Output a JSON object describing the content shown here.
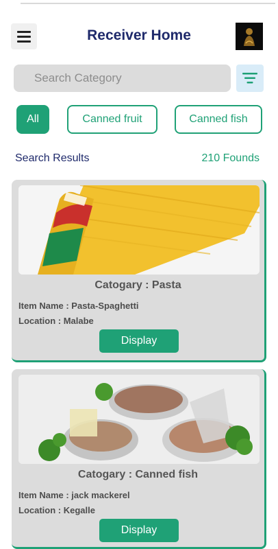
{
  "header": {
    "title": "Receiver Home"
  },
  "search": {
    "placeholder": "Search Category"
  },
  "chips": [
    {
      "label": "All",
      "active": true
    },
    {
      "label": "Canned fruit",
      "active": false
    },
    {
      "label": "Canned fish",
      "active": false
    }
  ],
  "results": {
    "label": "Search Results",
    "count": "210 Founds"
  },
  "cards": [
    {
      "category": "Catogary : Pasta",
      "item": "Item Name :  Pasta-Spaghetti",
      "location": "Location : Malabe",
      "button": "Display"
    },
    {
      "category": "Catogary : Canned fish",
      "item": "Item Name : jack mackerel",
      "location": "Location : Kegalle",
      "button": "Display"
    }
  ],
  "colors": {
    "accent": "#1fa176",
    "title": "#1f2a6b",
    "card_bg": "#dcdcdc"
  },
  "icons": {
    "menu": "hamburger-icon",
    "filter": "filter-icon"
  }
}
